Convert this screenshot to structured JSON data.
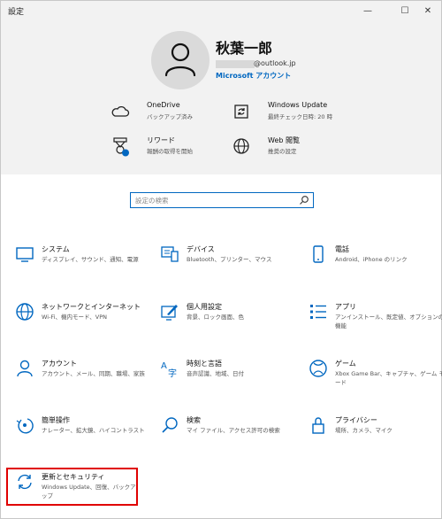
{
  "window": {
    "title": "設定"
  },
  "controls": {
    "minimize": "—",
    "maximize": "☐",
    "close": "✕"
  },
  "account": {
    "name": "秋葉一郎",
    "email_domain": "@outlook.jp",
    "link": "Microsoft アカウント"
  },
  "header_items": [
    {
      "icon": "onedrive-icon",
      "label": "OneDrive",
      "sub": "バックアップ済み"
    },
    {
      "icon": "windows-update-icon",
      "label": "Windows Update",
      "sub": "最終チェック日時: 20 時"
    },
    {
      "icon": "rewards-icon",
      "label": "リワード",
      "sub": "報酬の取得を開始"
    },
    {
      "icon": "web-browsing-icon",
      "label": "Web 閲覧",
      "sub": "推奨の設定"
    }
  ],
  "search": {
    "placeholder": "設定の検索"
  },
  "tiles": [
    {
      "icon": "system-icon",
      "label": "システム",
      "sub": "ディスプレイ、サウンド、通知、電源"
    },
    {
      "icon": "devices-icon",
      "label": "デバイス",
      "sub": "Bluetooth、プリンター、マウス"
    },
    {
      "icon": "phone-icon",
      "label": "電話",
      "sub": "Android、iPhone のリンク"
    },
    {
      "icon": "network-icon",
      "label": "ネットワークとインターネット",
      "sub": "Wi-Fi、機内モード、VPN"
    },
    {
      "icon": "personalization-icon",
      "label": "個人用設定",
      "sub": "背景、ロック画面、色"
    },
    {
      "icon": "apps-icon",
      "label": "アプリ",
      "sub": "アンインストール、既定値、オプションの機能"
    },
    {
      "icon": "accounts-icon",
      "label": "アカウント",
      "sub": "アカウント、メール、同期、職場、家族"
    },
    {
      "icon": "time-language-icon",
      "label": "時刻と言語",
      "sub": "音声認識、地域、日付"
    },
    {
      "icon": "gaming-icon",
      "label": "ゲーム",
      "sub": "Xbox Game Bar、キャプチャ、ゲーム モード"
    },
    {
      "icon": "ease-of-access-icon",
      "label": "簡単操作",
      "sub": "ナレーター、拡大鏡、ハイコントラスト"
    },
    {
      "icon": "search-icon",
      "label": "検索",
      "sub": "マイ ファイル、アクセス許可の検索"
    },
    {
      "icon": "privacy-icon",
      "label": "プライバシー",
      "sub": "場所、カメラ、マイク"
    },
    {
      "icon": "update-security-icon",
      "label": "更新とセキュリティ",
      "sub": "Windows Update、回復、バックアップ"
    }
  ],
  "colors": {
    "accent": "#0067c0",
    "highlight": "#e00000",
    "header_bg": "#f2f2f2"
  }
}
